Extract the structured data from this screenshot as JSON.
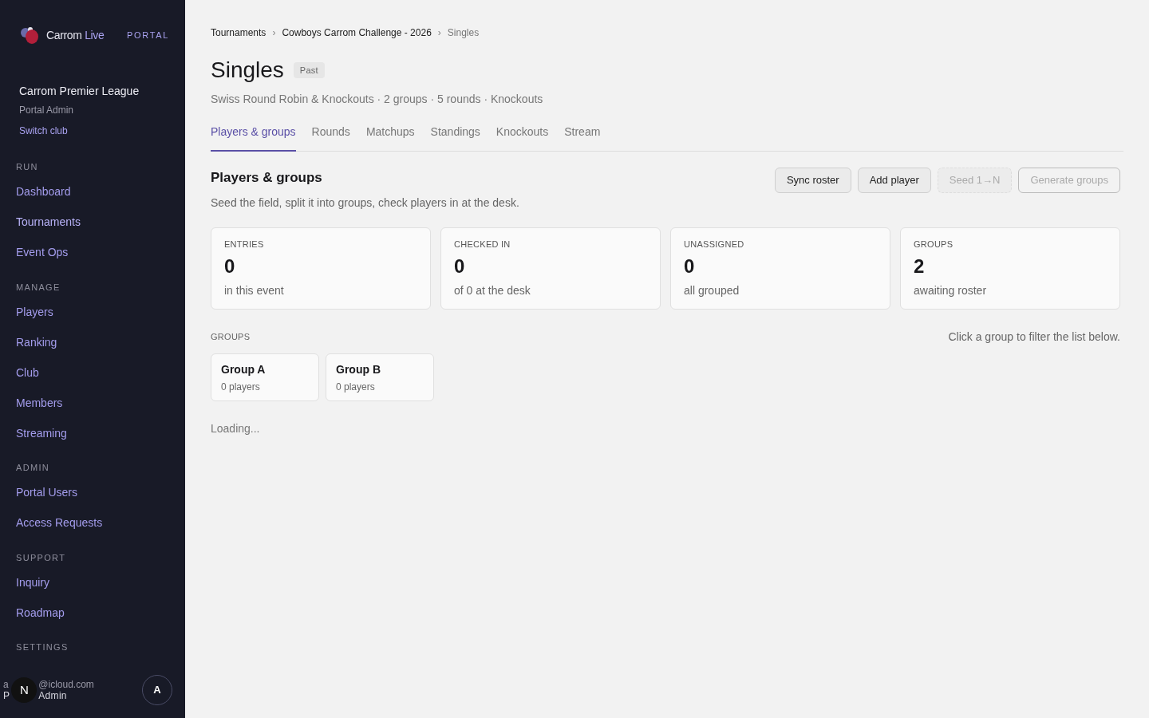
{
  "brand": {
    "name": "Carrom",
    "name_accent": "Live",
    "badge": "PORTAL"
  },
  "club": {
    "name": "Carrom Premier League",
    "role": "Portal Admin",
    "switch": "Switch club"
  },
  "nav": [
    {
      "heading": "RUN",
      "items": [
        {
          "label": "Dashboard",
          "selected": false
        },
        {
          "label": "Tournaments",
          "selected": true
        },
        {
          "label": "Event Ops",
          "selected": false
        }
      ]
    },
    {
      "heading": "MANAGE",
      "items": [
        {
          "label": "Players",
          "selected": false
        },
        {
          "label": "Ranking",
          "selected": false
        },
        {
          "label": "Club",
          "selected": false
        },
        {
          "label": "Members",
          "selected": false
        },
        {
          "label": "Streaming",
          "selected": false
        }
      ]
    },
    {
      "heading": "ADMIN",
      "items": [
        {
          "label": "Portal Users",
          "selected": false
        },
        {
          "label": "Access Requests",
          "selected": false
        }
      ]
    },
    {
      "heading": "SUPPORT",
      "items": [
        {
          "label": "Inquiry",
          "selected": false
        },
        {
          "label": "Roadmap",
          "selected": false
        }
      ]
    },
    {
      "heading": "SETTINGS"
    }
  ],
  "user": {
    "email_start": "a",
    "email_end": "@icloud.com",
    "role_start": "P",
    "role_end": "Admin",
    "overlay_badge": "N",
    "avatar": "A"
  },
  "breadcrumbs": [
    "Tournaments",
    "Cowboys Carrom Challenge - 2026",
    "Singles"
  ],
  "breadcrumb_separator": "›",
  "title": "Singles",
  "status": "Past",
  "subtitle": "Swiss Round Robin & Knockouts · 2 groups · 5 rounds · Knockouts",
  "tabs": [
    {
      "label": "Players & groups",
      "selected": true
    },
    {
      "label": "Rounds",
      "selected": false
    },
    {
      "label": "Matchups",
      "selected": false
    },
    {
      "label": "Standings",
      "selected": false
    },
    {
      "label": "Knockouts",
      "selected": false
    },
    {
      "label": "Stream",
      "selected": false
    }
  ],
  "section": {
    "title": "Players & groups",
    "description": "Seed the field, split it into groups, check players in at the desk."
  },
  "actions": [
    {
      "label": "Sync roster",
      "disabled": false,
      "kind": "filled"
    },
    {
      "label": "Add player",
      "disabled": false,
      "kind": "filled"
    },
    {
      "label": "Seed 1→N",
      "disabled": true,
      "kind": "filled"
    },
    {
      "label": "Generate groups",
      "disabled": true,
      "kind": "outline"
    }
  ],
  "stats": [
    {
      "label": "ENTRIES",
      "value": "0",
      "note": "in this event"
    },
    {
      "label": "CHECKED IN",
      "value": "0",
      "note": "of 0 at the desk"
    },
    {
      "label": "UNASSIGNED",
      "value": "0",
      "note": "all grouped"
    },
    {
      "label": "GROUPS",
      "value": "2",
      "note": "awaiting roster"
    }
  ],
  "groups": {
    "heading": "GROUPS",
    "hint": "Click a group to filter the list below.",
    "items": [
      {
        "name": "Group A",
        "count": "0 players"
      },
      {
        "name": "Group B",
        "count": "0 players"
      }
    ]
  },
  "loading": "Loading..."
}
